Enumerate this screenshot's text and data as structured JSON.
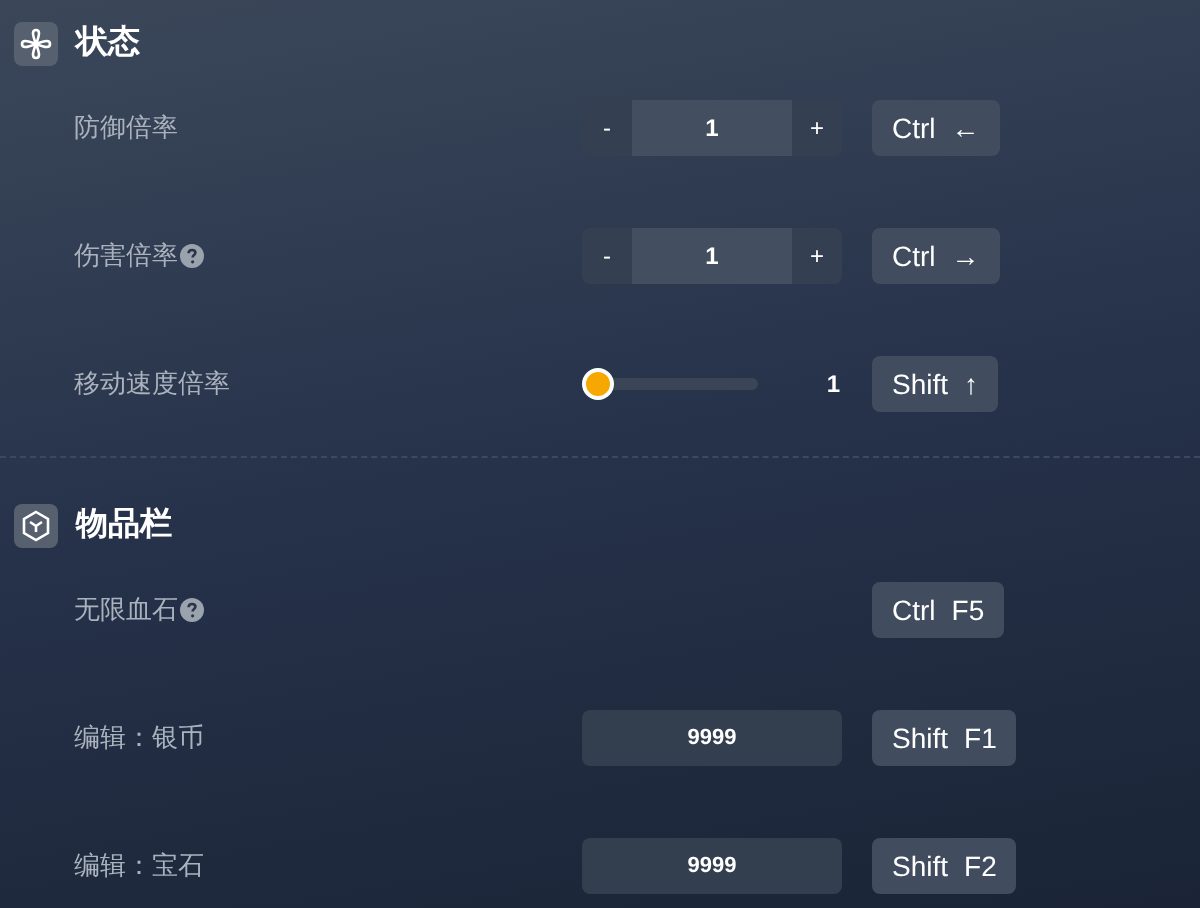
{
  "sections": [
    {
      "title": "状态",
      "rows": [
        {
          "kind": "stepper",
          "label": "防御倍率",
          "help": false,
          "minus": "-",
          "value": "1",
          "plus": "+",
          "keys": [
            "Ctrl",
            "←"
          ]
        },
        {
          "kind": "stepper",
          "label": "伤害倍率",
          "help": true,
          "minus": "-",
          "value": "1",
          "plus": "+",
          "keys": [
            "Ctrl",
            "→"
          ]
        },
        {
          "kind": "slider",
          "label": "移动速度倍率",
          "help": false,
          "level": 0,
          "reading": "1",
          "keys": [
            "Shift",
            "↑"
          ]
        }
      ]
    },
    {
      "title": "物品栏",
      "rows": [
        {
          "kind": "toggle",
          "label": "无限血石",
          "help": true,
          "keys": [
            "Ctrl",
            "F5"
          ]
        },
        {
          "kind": "input",
          "label": "编辑：银币",
          "help": false,
          "value": "9999",
          "keys": [
            "Shift",
            "F1"
          ]
        },
        {
          "kind": "input",
          "label": "编辑：宝石",
          "help": false,
          "value": "9999",
          "keys": [
            "Shift",
            "F2"
          ]
        }
      ]
    }
  ]
}
